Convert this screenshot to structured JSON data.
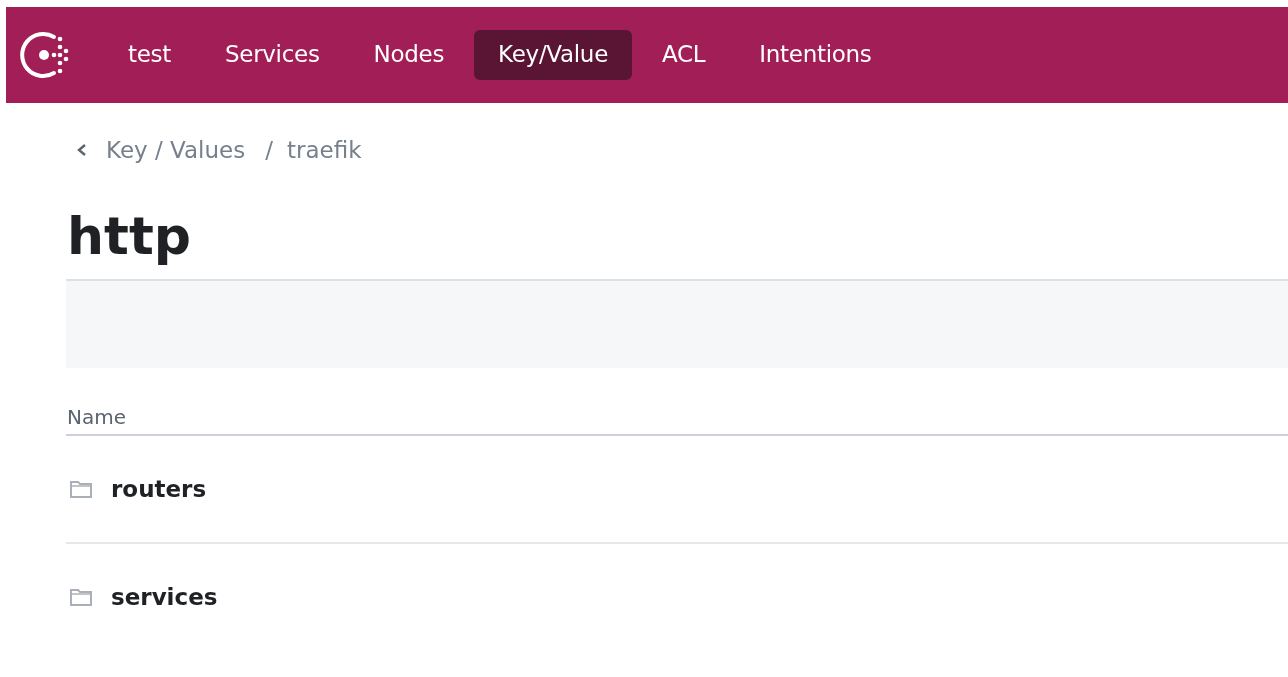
{
  "nav": {
    "items": [
      {
        "label": "test",
        "selected": false
      },
      {
        "label": "Services",
        "selected": false
      },
      {
        "label": "Nodes",
        "selected": false
      },
      {
        "label": "Key/Value",
        "selected": true
      },
      {
        "label": "ACL",
        "selected": false
      },
      {
        "label": "Intentions",
        "selected": false
      }
    ]
  },
  "breadcrumbs": [
    {
      "label": "Key / Values",
      "kind": "link"
    },
    {
      "label": "/",
      "kind": "separator"
    },
    {
      "label": "traefik",
      "kind": "link"
    }
  ],
  "title": "http",
  "table": {
    "columns": [
      "Name"
    ],
    "rows": [
      {
        "name": "routers",
        "kind": "folder"
      },
      {
        "name": "services",
        "kind": "folder"
      }
    ]
  }
}
